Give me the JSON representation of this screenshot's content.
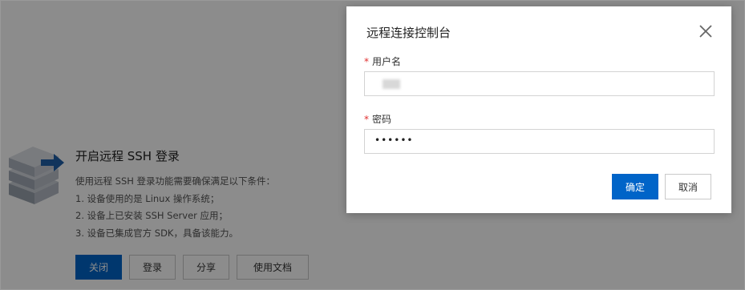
{
  "background_panel": {
    "title": "开启远程 SSH 登录",
    "description": [
      "使用远程 SSH 登录功能需要确保满足以下条件：",
      "1. 设备使用的是 Linux 操作系统；",
      "2. 设备上已安装 SSH Server 应用；",
      "3. 设备已集成官方 SDK，具备该能力。"
    ],
    "buttons": [
      "关闭",
      "登录",
      "分享",
      "使用文档"
    ]
  },
  "modal": {
    "title": "远程连接控制台",
    "username_label": "用户名",
    "password_label": "密码",
    "password_value": "••••••",
    "confirm_label": "确定",
    "cancel_label": "取消",
    "required_mark": "*"
  },
  "colors": {
    "primary": "#0064c8",
    "required": "#e03030",
    "overlay": "rgba(0,0,0,0.45)"
  },
  "icons": [
    "server-arrow-icon",
    "close-icon"
  ]
}
